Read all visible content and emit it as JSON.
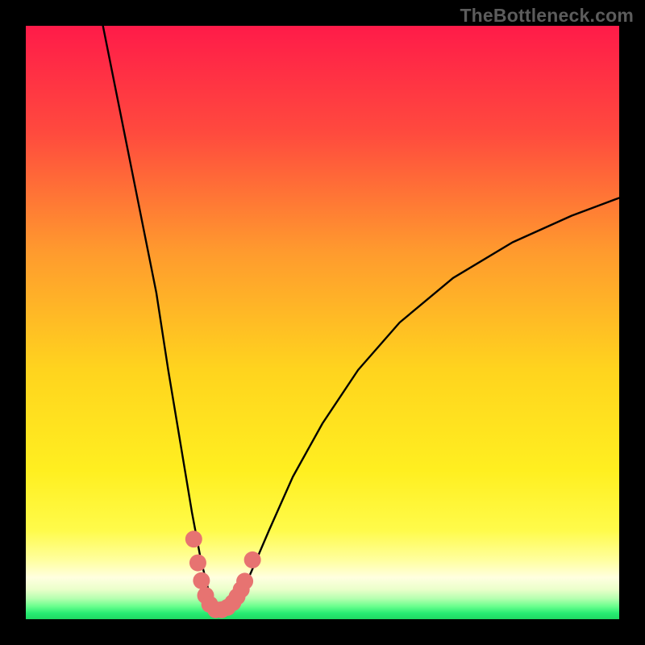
{
  "watermark": "TheBottleneck.com",
  "colors": {
    "frame": "#000000",
    "curve": "#000000",
    "markers": "#e77371",
    "green_band": "#27ec72",
    "gradient_top": "#ff1b49",
    "gradient_mid1": "#ff7d35",
    "gradient_mid2": "#ffe400",
    "gradient_low": "#ffff70"
  },
  "chart_data": {
    "type": "line",
    "title": "",
    "xlabel": "",
    "ylabel": "",
    "xlim": [
      0,
      100
    ],
    "ylim": [
      0,
      100
    ],
    "legend": false,
    "grid": false,
    "note": "Values estimated from pixel positions on an unlabeled axis; the vertical axis represents bottleneck percentage (0 = balanced, higher = worse).",
    "series": [
      {
        "name": "bottleneck-curve",
        "x": [
          13,
          16,
          19,
          22,
          24,
          26,
          28,
          29.5,
          31,
          32.5,
          34,
          36,
          38,
          41,
          45,
          50,
          56,
          63,
          72,
          82,
          92,
          100
        ],
        "y": [
          100,
          85,
          70,
          55,
          42,
          30,
          18,
          10,
          4,
          1.5,
          1.5,
          3.5,
          8,
          15,
          24,
          33,
          42,
          50,
          57.5,
          63.5,
          68,
          71
        ]
      }
    ],
    "markers": {
      "name": "highlighted-points",
      "x": [
        28.3,
        29.0,
        29.6,
        30.3,
        31.0,
        32.0,
        33.0,
        34.0,
        34.9,
        35.6,
        36.3,
        36.9,
        38.2
      ],
      "y": [
        13.5,
        9.5,
        6.5,
        4.0,
        2.5,
        1.6,
        1.6,
        2.0,
        2.8,
        3.8,
        5.0,
        6.4,
        10.0
      ]
    }
  }
}
